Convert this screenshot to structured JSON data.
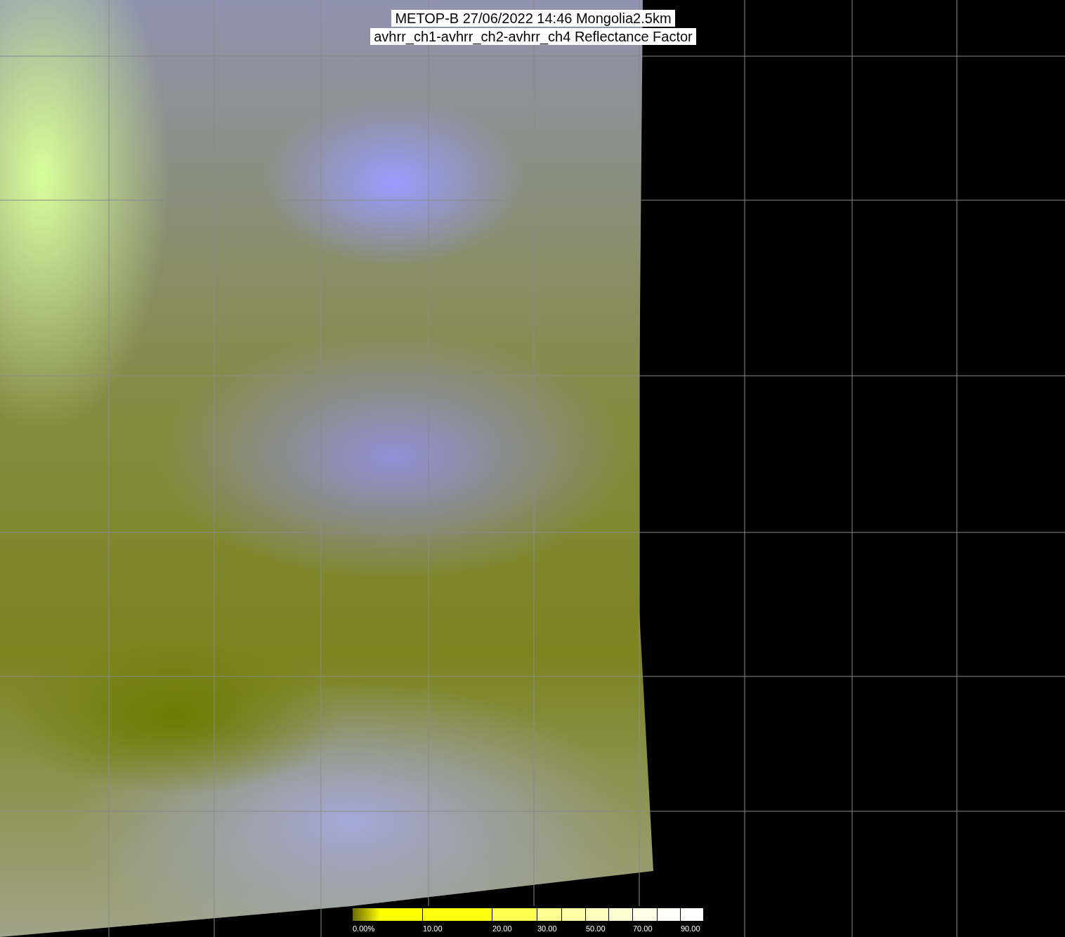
{
  "title": {
    "lines": [
      "METOP-B 27/06/2022 14:46 Mongolia2.5km",
      "avhrr_ch1-avhrr_ch2-avhrr_ch4 Reflectance Factor"
    ]
  },
  "colorbar": {
    "segments": [
      {
        "color": "#ffff00",
        "label": "0.00%"
      },
      {
        "color": "#ffff10",
        "label": "10.00"
      },
      {
        "color": "#ffff50",
        "label": "20.00"
      },
      {
        "color": "#ffff90",
        "label": "30.00"
      },
      {
        "color": "#ffffa8"
      },
      {
        "color": "#ffffc0",
        "label": "50.00"
      },
      {
        "color": "#ffffd4"
      },
      {
        "color": "#ffffe8",
        "label": "70.00"
      },
      {
        "color": "#fffff8"
      },
      {
        "color": "#ffffff",
        "label": "90.00"
      }
    ]
  }
}
